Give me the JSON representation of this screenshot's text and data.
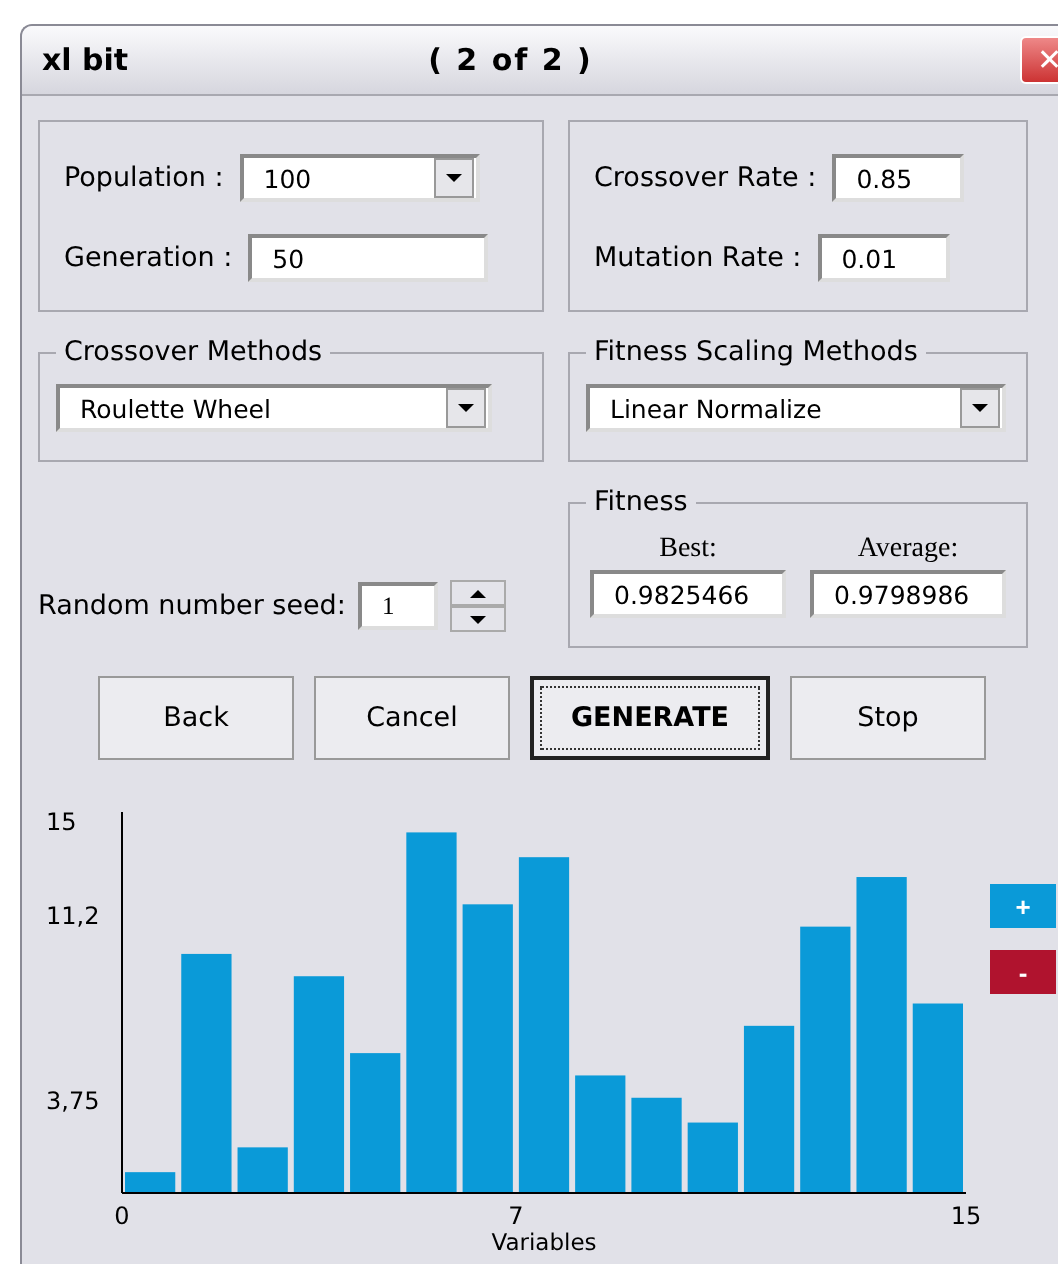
{
  "window": {
    "title": "xl bit",
    "subtitle": "( 2 of 2 )",
    "close": "✕"
  },
  "parameters": {
    "population": {
      "label": "Population :",
      "value": "100"
    },
    "generation": {
      "label": "Generation :",
      "value": "50"
    },
    "crossover_rate": {
      "label": "Crossover Rate :",
      "value": "0.85"
    },
    "mutation_rate": {
      "label": "Mutation Rate :",
      "value": "0.01"
    }
  },
  "crossover_methods": {
    "title": "Crossover Methods",
    "value": "Roulette Wheel"
  },
  "fitness_scaling_methods": {
    "title": "Fitness Scaling Methods",
    "value": "Linear Normalize"
  },
  "seed": {
    "label": "Random number seed:",
    "value": "1"
  },
  "fitness": {
    "title": "Fitness",
    "best_label": "Best:",
    "best": "0.9825466",
    "average_label": "Average:",
    "average": "0.9798986"
  },
  "buttons": [
    {
      "label": "Back",
      "focused": false
    },
    {
      "label": "Cancel",
      "focused": false
    },
    {
      "label": "GENERATE",
      "focused": true
    },
    {
      "label": "Stop",
      "focused": false
    }
  ],
  "zoom_buttons": [
    {
      "label": "+",
      "color": "#0a9ad8"
    },
    {
      "label": "-",
      "color": "#b0132e"
    }
  ],
  "chart_data": {
    "type": "bar",
    "xlabel": "Variables",
    "x": [
      0.5,
      1.5,
      2.5,
      3.5,
      4.5,
      5.5,
      6.5,
      7.5,
      8.5,
      9.5,
      10.5,
      11.5,
      12.5,
      13.5,
      14.5
    ],
    "xlim": [
      0,
      15
    ],
    "series": [
      {
        "color": "#0a9ad8",
        "values": [
          0.8,
          9.6,
          1.8,
          8.7,
          5.6,
          14.5,
          11.6,
          13.5,
          4.7,
          3.8,
          2.8,
          6.7,
          10.7,
          12.7,
          7.6
        ]
      }
    ],
    "ylim": [
      0,
      15
    ],
    "yticks": [
      {
        "value": 3.75,
        "label": "3,75"
      },
      {
        "value": 11.2,
        "label": "11,2"
      },
      {
        "value": 15,
        "label": "15"
      }
    ],
    "xticks": [
      {
        "value": 0,
        "label": "0"
      },
      {
        "value": 7,
        "label": "7"
      },
      {
        "value": 15,
        "label": "15"
      }
    ]
  }
}
